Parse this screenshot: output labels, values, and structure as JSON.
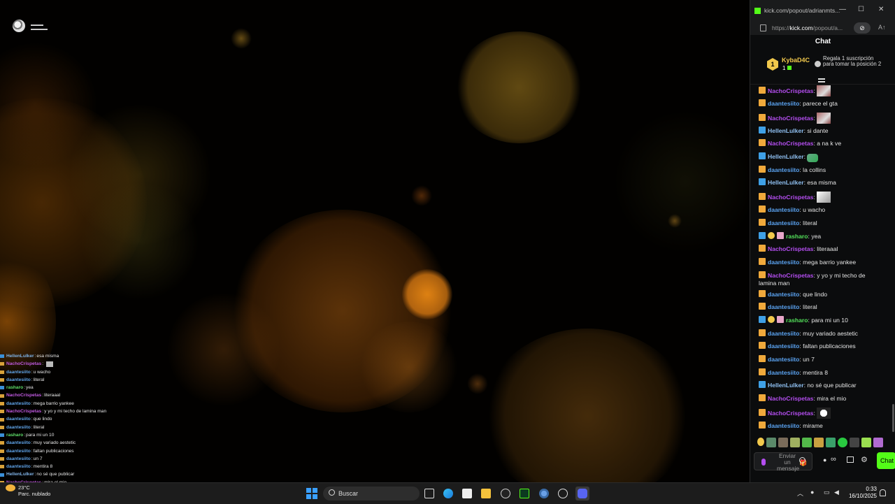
{
  "stream": {
    "overlay_chat": [
      {
        "user": "HellenLulker",
        "text": "esa misma",
        "badge": "blue",
        "color": "#7fb2e6"
      },
      {
        "user": "NachoCrispetas",
        "text": "",
        "emote": true,
        "badge": "crown",
        "color": "#c05ae0"
      },
      {
        "user": "daantesiito",
        "text": "u wacho",
        "badge": "crown",
        "color": "#5fa3e8"
      },
      {
        "user": "daantesiito",
        "text": "literal",
        "badge": "crown",
        "color": "#5fa3e8"
      },
      {
        "user": "rasharo",
        "text": "yea",
        "badge": "blue",
        "color": "#5fe06a"
      },
      {
        "user": "NachoCrispetas",
        "text": "literaaal",
        "badge": "crown",
        "color": "#c05ae0"
      },
      {
        "user": "daantesiito",
        "text": "mega barrio yankee",
        "badge": "crown",
        "color": "#5fa3e8"
      },
      {
        "user": "NachoCrispetas",
        "text": "y yo y mi techo de lamina man",
        "badge": "crown",
        "color": "#c05ae0"
      },
      {
        "user": "daantesiito",
        "text": "que lindo",
        "badge": "crown",
        "color": "#5fa3e8"
      },
      {
        "user": "daantesiito",
        "text": "literal",
        "badge": "crown",
        "color": "#5fa3e8"
      },
      {
        "user": "rasharo",
        "text": "para mi un 10",
        "badge": "blue",
        "color": "#5fe06a"
      },
      {
        "user": "daantesiito",
        "text": "muy variado aestetic",
        "badge": "crown",
        "color": "#5fa3e8"
      },
      {
        "user": "daantesiito",
        "text": "faltan publicaciones",
        "badge": "crown",
        "color": "#5fa3e8"
      },
      {
        "user": "daantesiito",
        "text": "un 7",
        "badge": "crown",
        "color": "#5fa3e8"
      },
      {
        "user": "daantesiito",
        "text": "mentira 8",
        "badge": "crown",
        "color": "#5fa3e8"
      },
      {
        "user": "HellenLulker",
        "text": "no sé que publicar",
        "badge": "blue",
        "color": "#7fb2e6"
      },
      {
        "user": "NachoCrispetas",
        "text": "mira el mio",
        "badge": "crown",
        "color": "#c05ae0"
      }
    ]
  },
  "taskbar": {
    "weather_temp": "23°C",
    "weather_desc": "Parc. nublado",
    "search_placeholder": "Buscar",
    "time": "0:33",
    "date": "16/10/2025"
  },
  "popup": {
    "tab_title": "kick.com/popout/adrianmts...",
    "url_prefix": "https://",
    "url_host": "kick.com",
    "url_path": "/popout/a...",
    "chat_title": "Chat",
    "pinned": {
      "rank": "1",
      "user": "KybaD4C",
      "count": "1",
      "text": "Regala 1 suscripción para tomar la posición 2"
    },
    "messages": [
      {
        "user": "NachoCrispetas",
        "color": "#b44ef0",
        "badges": [
          "crown"
        ],
        "text": "",
        "emote": "photo"
      },
      {
        "user": "daantesiito",
        "color": "#5aa2f0",
        "badges": [
          "crown"
        ],
        "text": "parece el gta"
      },
      {
        "user": "NachoCrispetas",
        "color": "#b44ef0",
        "badges": [
          "crown"
        ],
        "text": "",
        "emote": "photo"
      },
      {
        "user": "HellenLulker",
        "color": "#8fbff0",
        "badges": [
          "verified"
        ],
        "text": "si dante"
      },
      {
        "user": "NachoCrispetas",
        "color": "#b44ef0",
        "badges": [
          "crown"
        ],
        "text": "a na k ve"
      },
      {
        "user": "HellenLulker",
        "color": "#8fbff0",
        "badges": [
          "verified"
        ],
        "text": "",
        "emote": "small"
      },
      {
        "user": "daantesiito",
        "color": "#5aa2f0",
        "badges": [
          "crown"
        ],
        "text": "la collins"
      },
      {
        "user": "HellenLulker",
        "color": "#8fbff0",
        "badges": [
          "verified"
        ],
        "text": "esa misma"
      },
      {
        "user": "NachoCrispetas",
        "color": "#b44ef0",
        "badges": [
          "crown"
        ],
        "text": "",
        "emote": "white"
      },
      {
        "user": "daantesiito",
        "color": "#5aa2f0",
        "badges": [
          "crown"
        ],
        "text": "u wacho"
      },
      {
        "user": "daantesiito",
        "color": "#5aa2f0",
        "badges": [
          "crown"
        ],
        "text": "literal"
      },
      {
        "user": "rasharo",
        "color": "#53e05a",
        "badges": [
          "verified",
          "sub",
          "pink"
        ],
        "text": "yea"
      },
      {
        "user": "NachoCrispetas",
        "color": "#b44ef0",
        "badges": [
          "crown"
        ],
        "text": "literaaal"
      },
      {
        "user": "daantesiito",
        "color": "#5aa2f0",
        "badges": [
          "crown"
        ],
        "text": "mega barrio yankee"
      },
      {
        "user": "NachoCrispetas",
        "color": "#b44ef0",
        "badges": [
          "crown"
        ],
        "text": "y yo y mi techo de lamina man"
      },
      {
        "user": "daantesiito",
        "color": "#5aa2f0",
        "badges": [
          "crown"
        ],
        "text": "que lindo"
      },
      {
        "user": "daantesiito",
        "color": "#5aa2f0",
        "badges": [
          "crown"
        ],
        "text": "literal"
      },
      {
        "user": "rasharo",
        "color": "#53e05a",
        "badges": [
          "verified",
          "sub",
          "pink"
        ],
        "text": "para mi un 10"
      },
      {
        "user": "daantesiito",
        "color": "#5aa2f0",
        "badges": [
          "crown"
        ],
        "text": "muy variado aestetic"
      },
      {
        "user": "daantesiito",
        "color": "#5aa2f0",
        "badges": [
          "crown"
        ],
        "text": "faltan publicaciones"
      },
      {
        "user": "daantesiito",
        "color": "#5aa2f0",
        "badges": [
          "crown"
        ],
        "text": "un 7"
      },
      {
        "user": "daantesiito",
        "color": "#5aa2f0",
        "badges": [
          "crown"
        ],
        "text": "mentira 8"
      },
      {
        "user": "HellenLulker",
        "color": "#8fbff0",
        "badges": [
          "verified"
        ],
        "text": "no sé que publicar"
      },
      {
        "user": "NachoCrispetas",
        "color": "#b44ef0",
        "badges": [
          "crown"
        ],
        "text": "mira el mio"
      },
      {
        "user": "NachoCrispetas",
        "color": "#b44ef0",
        "badges": [
          "crown"
        ],
        "text": "",
        "emote": "panda"
      },
      {
        "user": "daantesiito",
        "color": "#5aa2f0",
        "badges": [
          "crown"
        ],
        "text": "mirame"
      }
    ],
    "input_placeholder": "Enviar un mensaje",
    "send_label": "Chat",
    "accent_color": "#53fc18"
  }
}
